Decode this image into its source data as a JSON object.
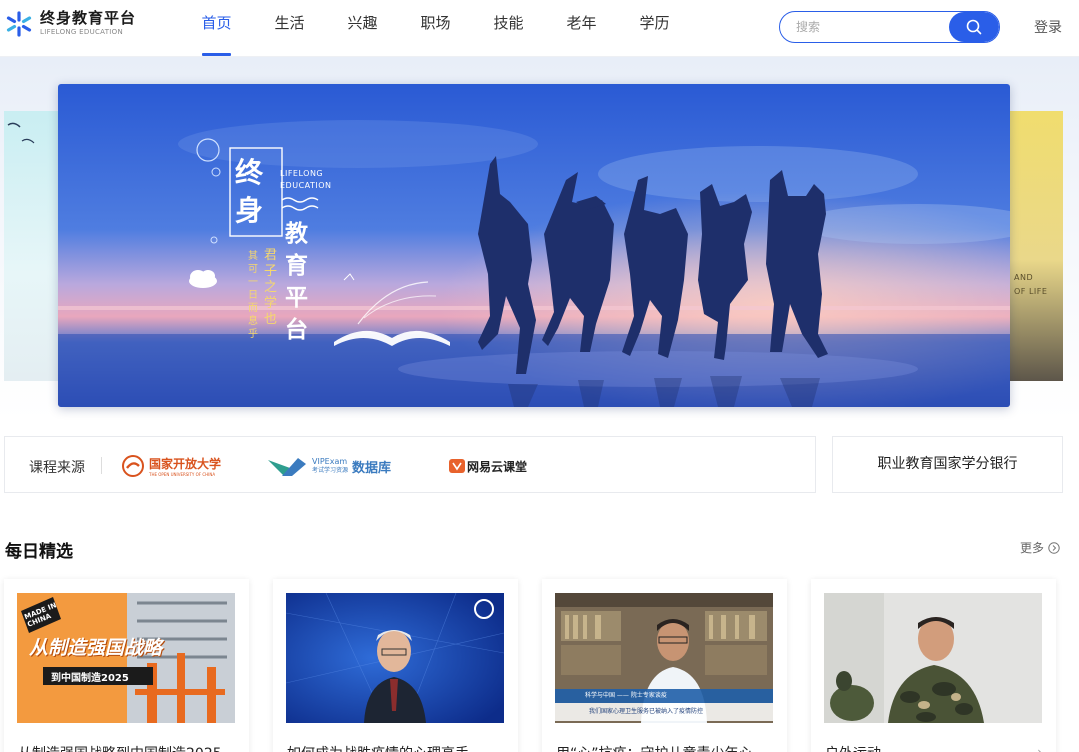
{
  "header": {
    "logo_title": "终身教育平台",
    "logo_subtitle": "LIFELONG EDUCATION",
    "nav": [
      {
        "label": "首页",
        "active": true
      },
      {
        "label": "生活",
        "active": false
      },
      {
        "label": "兴趣",
        "active": false
      },
      {
        "label": "职场",
        "active": false
      },
      {
        "label": "技能",
        "active": false
      },
      {
        "label": "老年",
        "active": false
      },
      {
        "label": "学历",
        "active": false
      }
    ],
    "search_placeholder": "搜索",
    "search_icon": "search-icon",
    "login_label": "登录"
  },
  "banner": {
    "title_chars": [
      "终",
      "身",
      "教",
      "育",
      "平",
      "台"
    ],
    "en_line1": "LIFELONG",
    "en_line2": "EDUCATION",
    "poem_col1": "君子之学也",
    "poem_col2": "其可一日而息乎",
    "right_peek_line1": "AND",
    "right_peek_line2": "OF LIFE"
  },
  "sources": {
    "label": "课程来源",
    "partners": [
      {
        "name": "国家开放大学",
        "sub": "THE OPEN UNIVERSITY OF CHINA",
        "color": "#d9531e"
      },
      {
        "name": "数据库",
        "sub_top": "VIPExam",
        "sub_bottom": "考试学习资源",
        "color": "#3b7bbf"
      },
      {
        "name": "网易云课堂",
        "color": "#e8622c"
      }
    ],
    "credit_bank": "职业教育国家学分银行"
  },
  "daily": {
    "title": "每日精选",
    "more_label": "更多",
    "cards": [
      {
        "title": "从制造强国战略到中国制造2025",
        "thumb_text1": "从制造强国战略",
        "thumb_text2": "到中国制造2025",
        "badge": "MADE IN CHINA"
      },
      {
        "title": "如何成为战胜疫情的心理高手"
      },
      {
        "title": "用“心”抗疫：守护儿童青少年心",
        "caption1": "科学与中国 —— 院士专家谈疫",
        "caption2": "我们国家心理卫生服务已被纳入了疫情防控"
      },
      {
        "title": "户外运动",
        "arrow": "›"
      }
    ]
  },
  "colors": {
    "brand_blue": "#2a5ee8",
    "banner_sky": "#2c5fd6",
    "banner_sunset": "#e79ab6"
  }
}
